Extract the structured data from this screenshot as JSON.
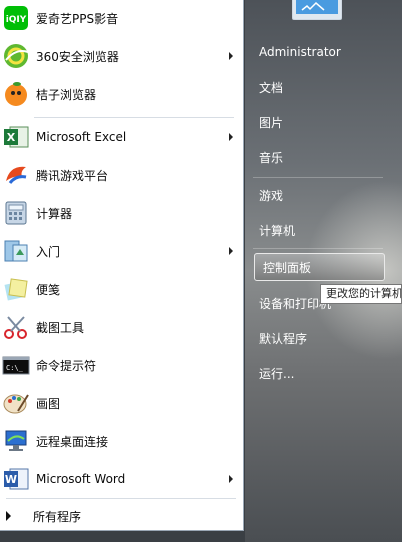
{
  "programs": [
    {
      "label": "爱奇艺PPS影音",
      "icon": "iqiyi-icon",
      "submenu": false
    },
    {
      "label": "360安全浏览器",
      "icon": "360-browser-icon",
      "submenu": true
    },
    {
      "label": "桔子浏览器",
      "icon": "orange-browser-icon",
      "submenu": false
    },
    {
      "label": "Microsoft Excel",
      "icon": "excel-icon",
      "submenu": true
    },
    {
      "label": "腾讯游戏平台",
      "icon": "tencent-games-icon",
      "submenu": false
    },
    {
      "label": "计算器",
      "icon": "calculator-icon",
      "submenu": false
    },
    {
      "label": "入门",
      "icon": "getting-started-icon",
      "submenu": true
    },
    {
      "label": "便笺",
      "icon": "sticky-notes-icon",
      "submenu": false
    },
    {
      "label": "截图工具",
      "icon": "snipping-tool-icon",
      "submenu": false
    },
    {
      "label": "命令提示符",
      "icon": "command-prompt-icon",
      "submenu": false
    },
    {
      "label": "画图",
      "icon": "paint-icon",
      "submenu": false
    },
    {
      "label": "远程桌面连接",
      "icon": "remote-desktop-icon",
      "submenu": false
    },
    {
      "label": "Microsoft Word",
      "icon": "word-icon",
      "submenu": true
    }
  ],
  "all_programs_label": "所有程序",
  "right": {
    "items": [
      {
        "label": "Administrator"
      },
      {
        "label": "文档"
      },
      {
        "label": "图片"
      },
      {
        "label": "音乐"
      },
      {
        "label": "游戏"
      },
      {
        "label": "计算机"
      },
      {
        "label": "控制面板"
      },
      {
        "label": "设备和打印机"
      },
      {
        "label": "默认程序"
      },
      {
        "label": "运行..."
      }
    ]
  },
  "tooltip": "更改您的计算机",
  "colors": {
    "accent_excel": "#1d7a3a",
    "accent_word": "#2b5caa",
    "selected_border": "#e9e9e9"
  }
}
